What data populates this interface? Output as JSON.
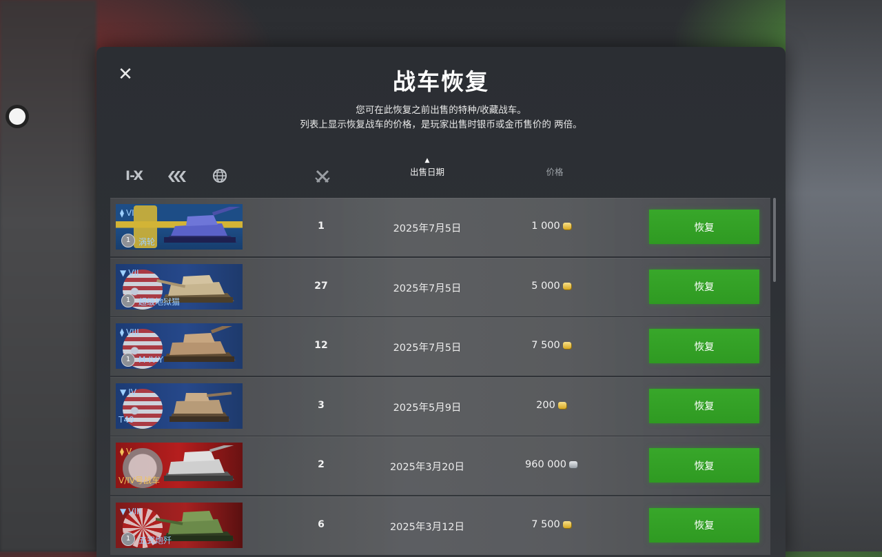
{
  "window": {
    "title": "战车恢复",
    "description_line1": "您可在此恢复之前出售的特种/收藏战车。",
    "description_line2": "列表上显示恢复战车的价格，是玩家出售时银币或金币售价的 两倍。"
  },
  "filters": {
    "tier_label": "I-X",
    "type_icon": "vehicle-type-icon",
    "nation_icon": "globe-icon"
  },
  "columns": {
    "battles_icon": "crossed-swords-icon",
    "sale_date": "出售日期",
    "sort_indicator": "▲",
    "price": "价格"
  },
  "colors": {
    "restore_button": "#34a126",
    "gold_text": "#f3c35a",
    "blue_text": "#9fd0ff"
  },
  "rows": [
    {
      "tier": "VI",
      "rank": "1",
      "name": "涡轮",
      "nation": "sweden",
      "battles": "1",
      "date": "2025年7月5日",
      "price": "1 000",
      "currency": "gold",
      "action": "恢复"
    },
    {
      "tier": "VII",
      "rank": "1",
      "name": "超级地狱猫",
      "nation": "usa",
      "battles": "27",
      "date": "2025年7月5日",
      "price": "5 000",
      "currency": "gold",
      "action": "恢复"
    },
    {
      "tier": "VIII",
      "rank": "1",
      "name": "M-IV-Y",
      "nation": "usa",
      "battles": "12",
      "date": "2025年7月5日",
      "price": "7 500",
      "currency": "gold",
      "action": "恢复"
    },
    {
      "tier": "IV",
      "rank": "",
      "name": "T40",
      "nation": "usa",
      "battles": "3",
      "date": "2025年5月9日",
      "price": "200",
      "currency": "gold",
      "action": "恢复"
    },
    {
      "tier": "V",
      "rank": "",
      "name": "V/IV号战车",
      "nation": "germany",
      "battles": "2",
      "date": "2025年3月20日",
      "price": "960 000",
      "currency": "silver",
      "action": "恢复"
    },
    {
      "tier": "VIII",
      "rank": "1",
      "name": "五式炮歼",
      "nation": "japan",
      "battles": "6",
      "date": "2025年3月12日",
      "price": "7 500",
      "currency": "gold",
      "action": "恢复"
    }
  ]
}
